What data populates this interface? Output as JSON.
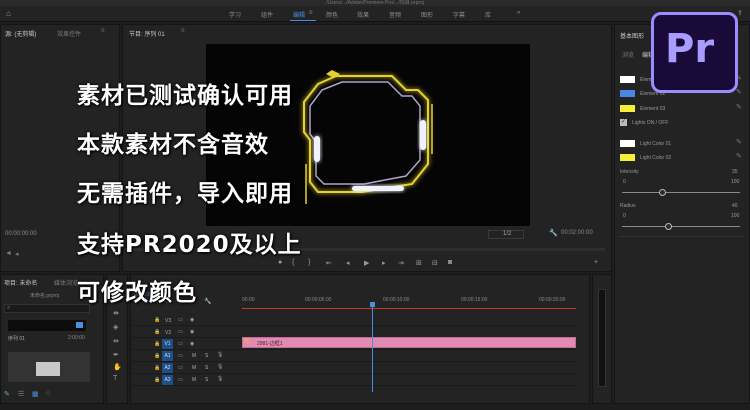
{
  "title_bar": {
    "text": "/Users/.../Adobe/Premiere Pro/.../项目.prproj"
  },
  "workspaces": [
    {
      "label": "学习"
    },
    {
      "label": "组件"
    },
    {
      "label": "编辑"
    },
    {
      "label": "颜色"
    },
    {
      "label": "效果"
    },
    {
      "label": "音频"
    },
    {
      "label": "图形"
    },
    {
      "label": "字幕"
    },
    {
      "label": "库"
    }
  ],
  "source_panel": {
    "tab_source": "源: (无剪辑)",
    "tab_effects": "效果控件",
    "timecode": "00:00:00:00"
  },
  "program_panel": {
    "tab": "节目: 序列 01",
    "timecode_left": "00:00:00:00",
    "resolution": "1/2",
    "timecode_right": "00:02:00:00"
  },
  "project_panel": {
    "tab_project": "项目: 未命名",
    "tab_browser": "媒体浏览",
    "project_file": "未命名.prproj",
    "search_placeholder": "",
    "item_name": "序列 01",
    "item_duration": "2:00:00"
  },
  "timeline": {
    "timecode": "00:00:00:00",
    "ruler": [
      "00:00",
      "00:00:05:00",
      "00:00:10:00",
      "00:00:15:00",
      "00:00:20:00"
    ],
    "clip_label": "2981-边框1",
    "tracks_video": [
      "V3",
      "V2",
      "V1"
    ],
    "tracks_audio": [
      "A1",
      "A2",
      "A3"
    ],
    "audio_flags": [
      "M",
      "S"
    ]
  },
  "essential_graphics": {
    "title": "基本图形",
    "tab_browse": "浏览",
    "tab_edit": "编辑",
    "elements": [
      {
        "label": "Element 01",
        "color": "#ffffff"
      },
      {
        "label": "Element 02",
        "color": "#4a86e0"
      },
      {
        "label": "Element 03",
        "color": "#f5ef3a"
      }
    ],
    "lights_toggle": "Lights ON / OFF",
    "light_colors": [
      {
        "label": "Light Color 01",
        "color": "#ffffff"
      },
      {
        "label": "Light Color 02",
        "color": "#f5ef3a"
      }
    ],
    "intensity": {
      "label": "Intensity",
      "value": "35",
      "min": "0",
      "max": "100",
      "level": 35
    },
    "radius": {
      "label": "Radius",
      "value": "40",
      "min": "0",
      "max": "100",
      "level": 40
    }
  },
  "overlay_text": [
    "素材已测试确认可用",
    "本款素材不含音效",
    "无需插件，导入即用",
    "支持PR2020及以上",
    "可修改颜色"
  ],
  "logo": {
    "text": "Pr"
  },
  "colors": {
    "accent_blue": "#4a90e2",
    "clip_pink": "#e28bb0",
    "playhead": "#4a90e2",
    "hud_yellow": "#e8d22a",
    "light_white": "#e8eaff"
  }
}
